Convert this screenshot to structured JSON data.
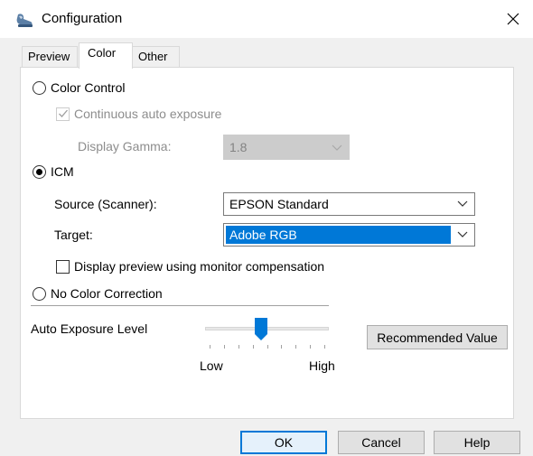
{
  "window": {
    "title": "Configuration"
  },
  "tabs": [
    {
      "label": "Preview",
      "active": false
    },
    {
      "label": "Color",
      "active": true
    },
    {
      "label": "Other",
      "active": false
    }
  ],
  "color_control": {
    "label": "Color Control",
    "selected": false,
    "continuous_auto_exposure": {
      "label": "Continuous auto exposure",
      "checked": true,
      "enabled": false
    },
    "display_gamma": {
      "label": "Display Gamma:",
      "value": "1.8",
      "enabled": false
    }
  },
  "icm": {
    "label": "ICM",
    "selected": true,
    "source": {
      "label": "Source (Scanner):",
      "value": "EPSON Standard"
    },
    "target": {
      "label": "Target:",
      "value": "Adobe RGB"
    },
    "monitor_compensation": {
      "label": "Display preview using monitor compensation",
      "checked": false
    }
  },
  "no_color_correction": {
    "label": "No Color Correction",
    "selected": false
  },
  "auto_exposure": {
    "label": "Auto Exposure Level",
    "level_fraction": 0.45,
    "tick_count": 9,
    "low_label": "Low",
    "high_label": "High",
    "recommended_button": "Recommended Value"
  },
  "buttons": {
    "ok": "OK",
    "cancel": "Cancel",
    "help": "Help"
  },
  "colors": {
    "accent": "#0078d7",
    "selection": "#0078d7",
    "dialog_bg": "#f0f0f0",
    "disabled_text": "#8d8d8d"
  },
  "icons": {
    "app": "scanner-app-icon",
    "close": "close-icon",
    "combo": "chevron-down-icon",
    "check": "checkmark-icon"
  }
}
